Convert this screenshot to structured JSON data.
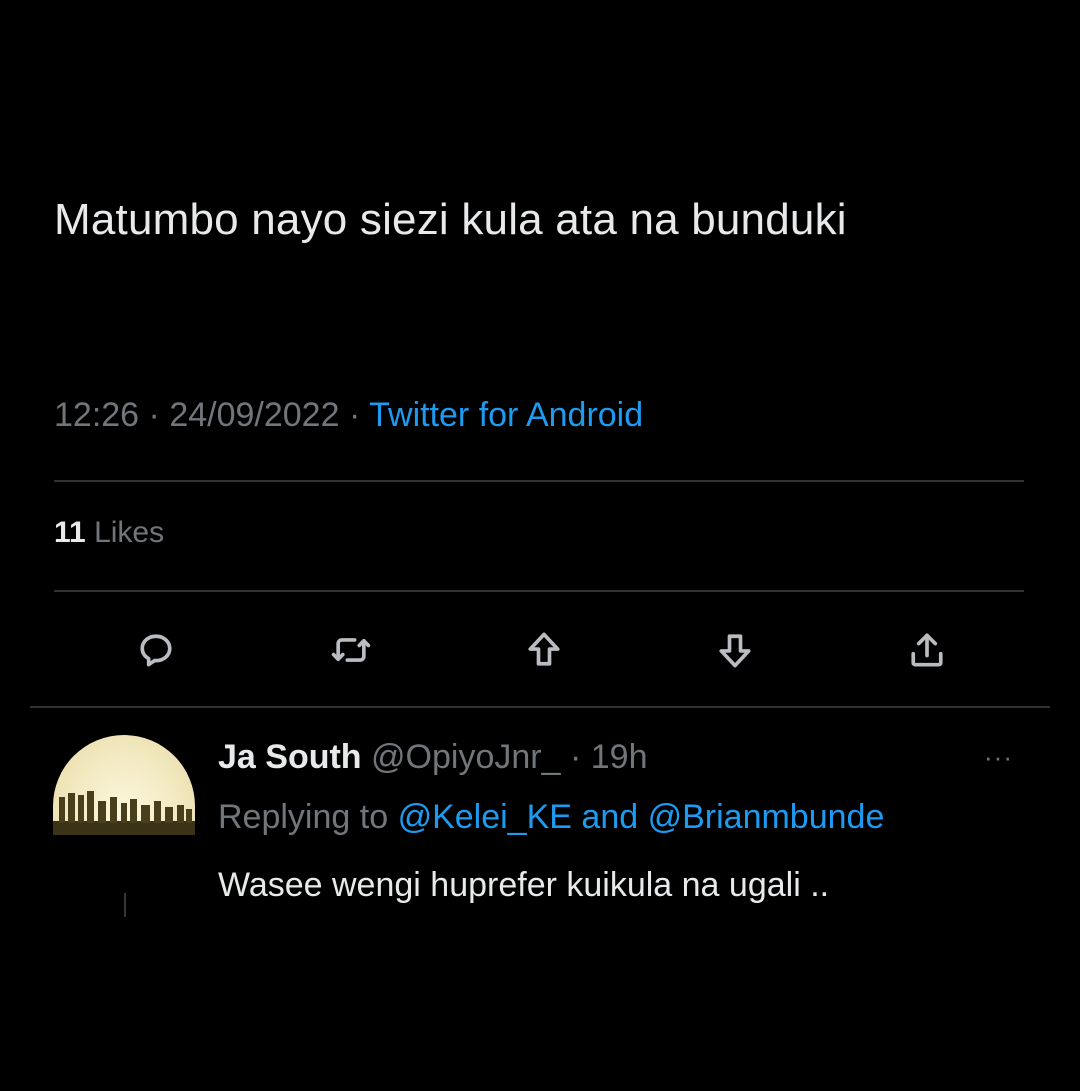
{
  "tweet": {
    "text": "Matumbo nayo siezi kula ata na bunduki",
    "time": "12:26",
    "date": "24/09/2022",
    "separator": "·",
    "source": "Twitter for Android",
    "likes_count": "11",
    "likes_label": "Likes"
  },
  "actions": [
    {
      "name": "reply",
      "icon": "comment-icon"
    },
    {
      "name": "retweet",
      "icon": "retweet-icon"
    },
    {
      "name": "upvote",
      "icon": "upvote-arrow-icon"
    },
    {
      "name": "downvote",
      "icon": "downvote-arrow-icon"
    },
    {
      "name": "share",
      "icon": "share-icon"
    }
  ],
  "reply": {
    "name": "Ja South",
    "handle": "@OpiyoJnr_",
    "separator": "·",
    "time": "19h",
    "more": "···",
    "replying_to_label": "Replying to",
    "mention_1": "@Kelei_KE",
    "and_label": "and",
    "mention_2": "@Brianmbunde",
    "text": "Wasee wengi huprefer kuikula na ugali .."
  },
  "colors": {
    "background": "#000000",
    "text": "#e7e9ea",
    "muted": "#71767b",
    "link": "#1d9bf0",
    "divider": "#2f3336"
  }
}
